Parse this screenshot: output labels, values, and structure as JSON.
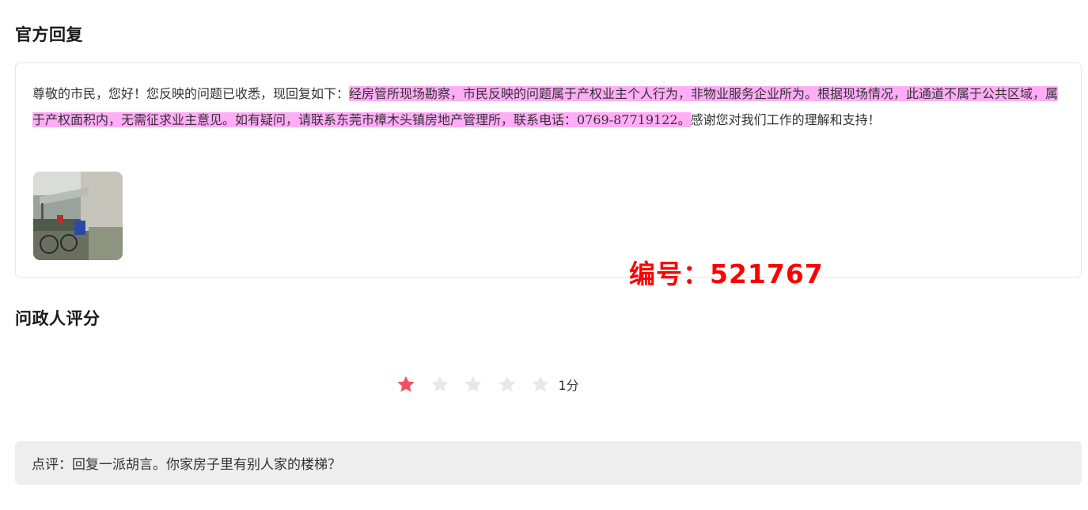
{
  "reply_section": {
    "title": "官方回复",
    "text_plain_start": "尊敬的市民，您好！您反映的问题已收悉，现回复如下：",
    "text_highlighted": "经房管所现场勘察，市民反映的问题属于产权业主个人行为，非物业服务企业所为。根据现场情况，此通道不属于公共区域，属于产权面积内，无需征求业主意见。如有疑问，请联系东莞市樟木头镇房地产管理所，联系电话：0769-87719122。",
    "text_plain_end": "感谢您对我们工作的理解和支持！",
    "highlight_color": "#ffadf6",
    "image_icon": "photo-thumbnail"
  },
  "watermark": {
    "text": "编号：521767",
    "color": "#ff0000"
  },
  "rating_section": {
    "title": "问政人评分",
    "score": 1,
    "max_score": 5,
    "score_label": "1分",
    "filled_color": "#f5505d",
    "empty_color": "#e8e8e8"
  },
  "comment": {
    "text": "点评：回复一派胡言。你家房子里有别人家的楼梯？"
  }
}
